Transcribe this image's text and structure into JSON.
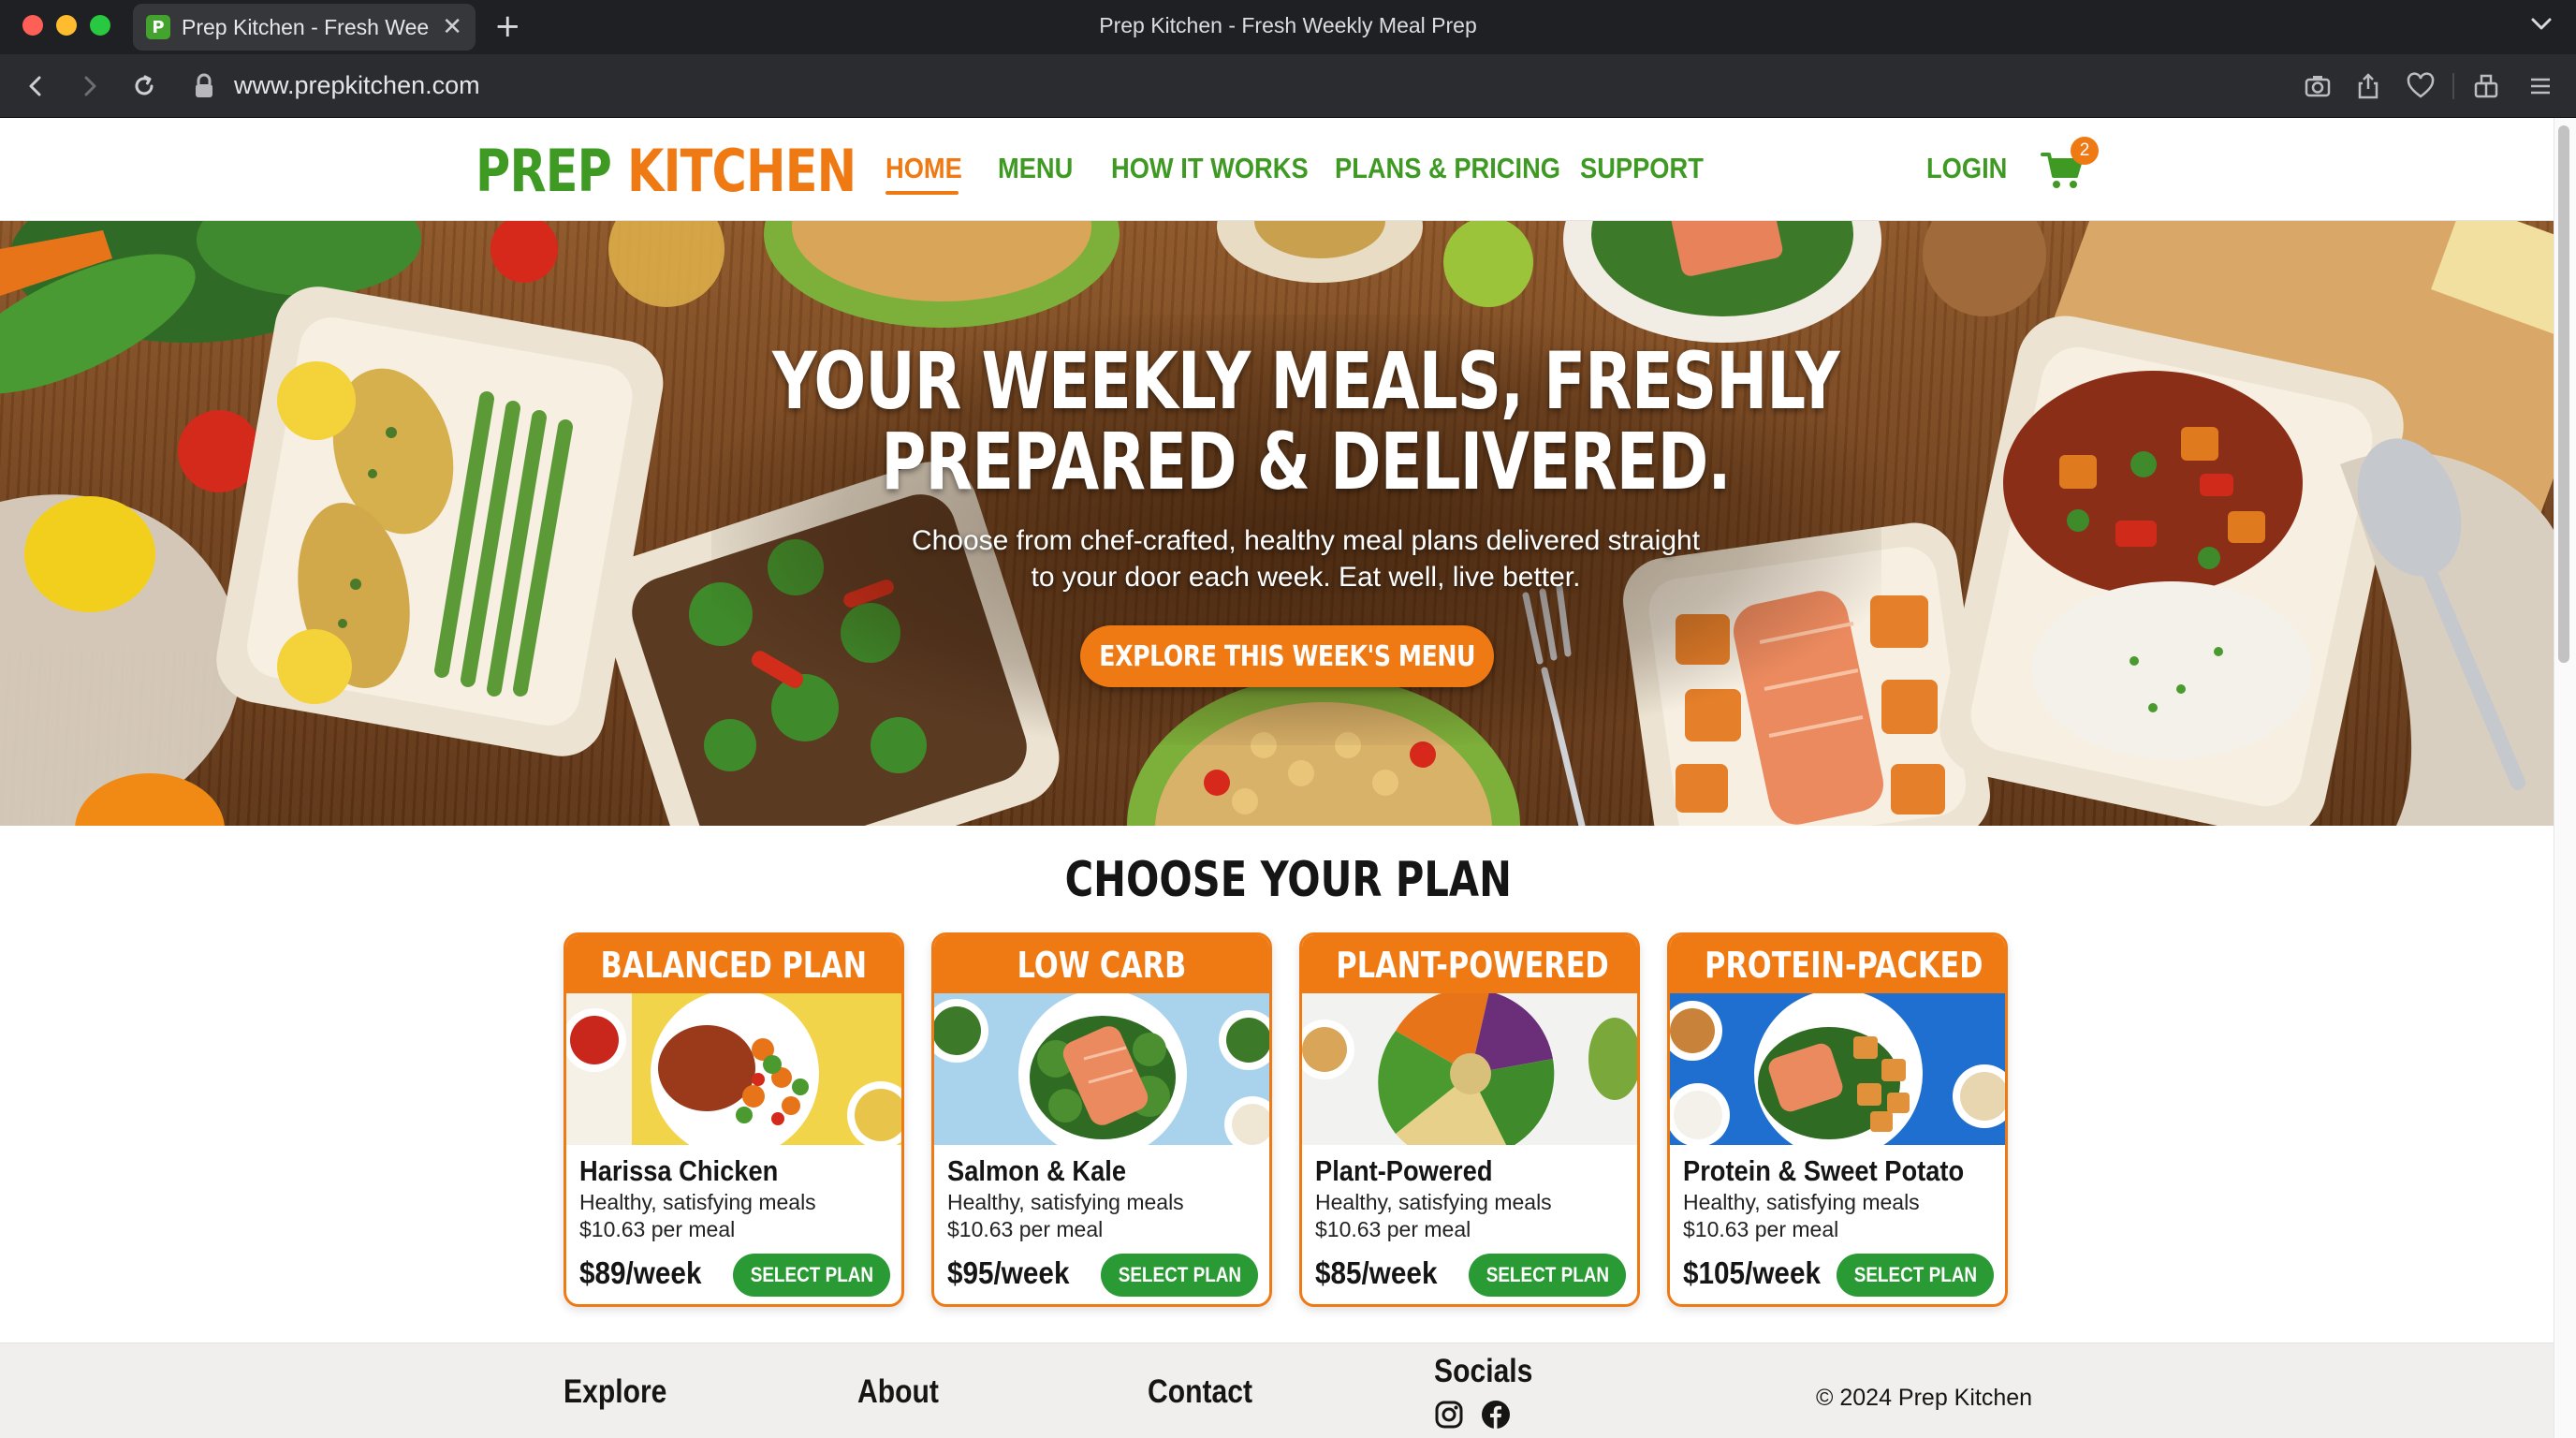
{
  "browser": {
    "tab_title": "Prep Kitchen - Fresh Weekly Meal Prep",
    "tab_title_truncated": "Prep Kitchen - Fresh Wee",
    "favicon_letter": "P",
    "window_title": "Prep Kitchen - Fresh Weekly Meal Prep",
    "url": "www.prepkitchen.com"
  },
  "header": {
    "logo_part1": "PREP",
    "logo_part2": "KITCHEN",
    "nav": [
      {
        "label": "HOME",
        "active": true
      },
      {
        "label": "MENU",
        "active": false
      },
      {
        "label": "HOW IT WORKS",
        "active": false
      },
      {
        "label": "PLANS & PRICING",
        "active": false
      },
      {
        "label": "SUPPORT",
        "active": false
      }
    ],
    "login": "LOGIN",
    "cart_count": "2"
  },
  "hero": {
    "title_line1": "YOUR WEEKLY MEALS, FRESHLY",
    "title_line2": "PREPARED & DELIVERED.",
    "subtitle_line1": "Choose from chef-crafted, healthy meal plans delivered straight",
    "subtitle_line2": "to your door each week. Eat well, live better.",
    "cta": "EXPLORE THIS WEEK'S MENU"
  },
  "plans": {
    "title": "CHOOSE YOUR PLAN",
    "items": [
      {
        "name": "BALANCED PLAN",
        "meal": "Harissa Chicken",
        "desc": "Healthy, satisfying meals",
        "per_meal": "$10.63 per meal",
        "price": "$89/week",
        "button": "SELECT PLAN"
      },
      {
        "name": "LOW CARB",
        "meal": "Salmon & Kale",
        "desc": "Healthy, satisfying meals",
        "per_meal": "$10.63 per meal",
        "price": "$95/week",
        "button": "SELECT PLAN"
      },
      {
        "name": "PLANT-POWERED",
        "meal": "Plant-Powered",
        "desc": "Healthy, satisfying meals",
        "per_meal": "$10.63 per meal",
        "price": "$85/week",
        "button": "SELECT PLAN"
      },
      {
        "name": "PROTEIN-PACKED",
        "meal": "Protein & Sweet Potato",
        "desc": "Healthy, satisfying meals",
        "per_meal": "$10.63 per meal",
        "price": "$105/week",
        "button": "SELECT PLAN"
      }
    ]
  },
  "footer": {
    "explore": "Explore",
    "about": "About",
    "contact": "Contact",
    "socials": "Socials",
    "copyright": "© 2024 Prep Kitchen"
  },
  "colors": {
    "brand_green": "#3f9a24",
    "brand_orange": "#ef7a14",
    "button_green": "#2a9a35"
  }
}
